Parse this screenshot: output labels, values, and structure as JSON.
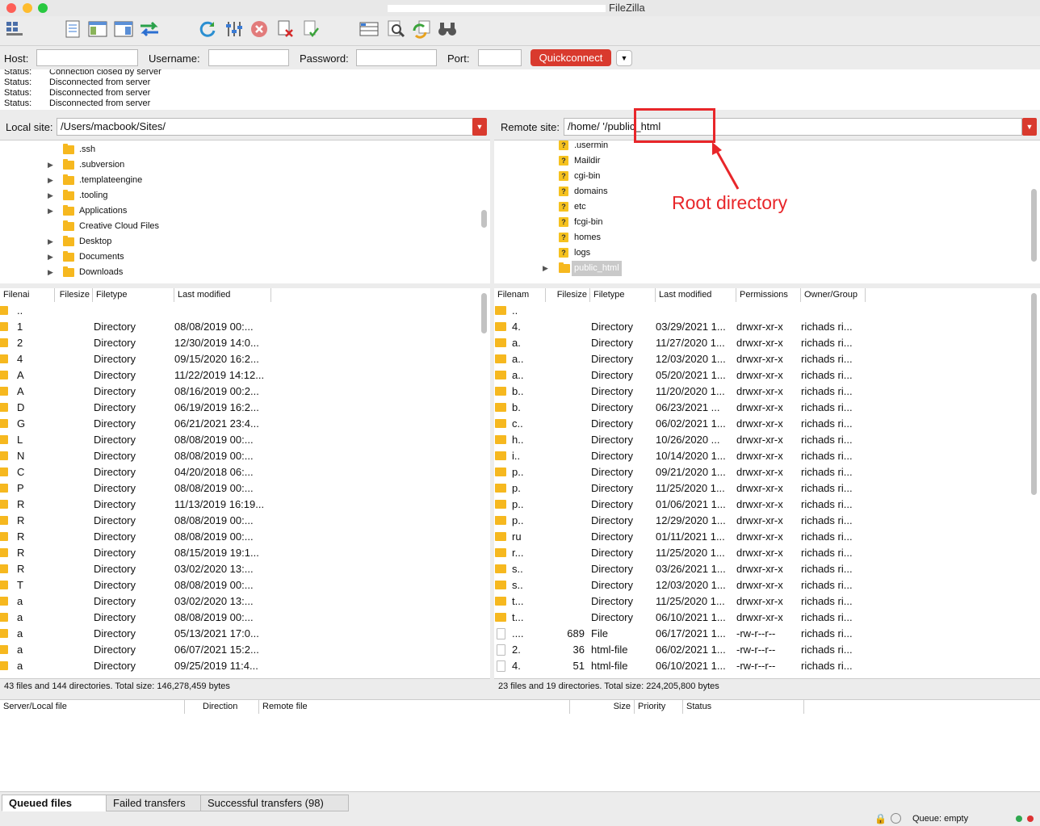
{
  "window": {
    "title": "FileZilla"
  },
  "toolbar": {
    "icons": [
      "site-manager-icon",
      "toggle-log-icon",
      "toggle-local-tree-icon",
      "toggle-remote-tree-icon",
      "transfer-queue-icon",
      "refresh-icon",
      "process-queue-icon",
      "cancel-icon",
      "disconnect-icon",
      "reconnect-icon",
      "filter-icon",
      "compare-icon",
      "sync-browse-icon",
      "search-icon"
    ]
  },
  "quickconnect": {
    "host_label": "Host:",
    "username_label": "Username:",
    "password_label": "Password:",
    "port_label": "Port:",
    "host_value": "",
    "username_value": "",
    "password_value": "",
    "port_value": "",
    "button_label": "Quickconnect"
  },
  "log": [
    {
      "key": "Status:",
      "msg": "Connection closed by server"
    },
    {
      "key": "Status:",
      "msg": "Disconnected from server"
    },
    {
      "key": "Status:",
      "msg": "Disconnected from server"
    },
    {
      "key": "Status:",
      "msg": "Disconnected from server"
    }
  ],
  "local": {
    "label": "Local site:",
    "path": "/Users/macbook/Sites/",
    "tree": [
      {
        "name": ".ssh",
        "arrow": false
      },
      {
        "name": ".subversion",
        "arrow": true
      },
      {
        "name": ".templateengine",
        "arrow": true
      },
      {
        "name": ".tooling",
        "arrow": true
      },
      {
        "name": "Applications",
        "arrow": true
      },
      {
        "name": "Creative Cloud Files",
        "arrow": false
      },
      {
        "name": "Desktop",
        "arrow": true
      },
      {
        "name": "Documents",
        "arrow": true
      },
      {
        "name": "Downloads",
        "arrow": true
      }
    ],
    "headers": [
      "Filenai",
      "Filesize",
      "Filetype",
      "Last modified"
    ],
    "rows": [
      {
        "n": "..",
        "t": "",
        "m": ""
      },
      {
        "n": "1",
        "t": "Directory",
        "m": "08/08/2019 00:..."
      },
      {
        "n": "2",
        "t": "Directory",
        "m": "12/30/2019 14:0..."
      },
      {
        "n": "4",
        "t": "Directory",
        "m": "09/15/2020 16:2..."
      },
      {
        "n": "A",
        "t": "Directory",
        "m": "11/22/2019 14:12..."
      },
      {
        "n": "A",
        "t": "Directory",
        "m": "08/16/2019 00:2..."
      },
      {
        "n": "D",
        "t": "Directory",
        "m": "06/19/2019 16:2..."
      },
      {
        "n": "G",
        "t": "Directory",
        "m": "06/21/2021 23:4..."
      },
      {
        "n": "L",
        "t": "Directory",
        "m": "08/08/2019 00:..."
      },
      {
        "n": "N",
        "t": "Directory",
        "m": "08/08/2019 00:..."
      },
      {
        "n": "C",
        "t": "Directory",
        "m": "04/20/2018 06:..."
      },
      {
        "n": "P",
        "t": "Directory",
        "m": "08/08/2019 00:..."
      },
      {
        "n": "R",
        "t": "Directory",
        "m": "11/13/2019 16:19..."
      },
      {
        "n": "R",
        "t": "Directory",
        "m": "08/08/2019 00:..."
      },
      {
        "n": "R",
        "t": "Directory",
        "m": "08/08/2019 00:..."
      },
      {
        "n": "R",
        "t": "Directory",
        "m": "08/15/2019 19:1..."
      },
      {
        "n": "R",
        "t": "Directory",
        "m": "03/02/2020 13:..."
      },
      {
        "n": "T",
        "t": "Directory",
        "m": "08/08/2019 00:..."
      },
      {
        "n": "a",
        "t": "Directory",
        "m": "03/02/2020 13:..."
      },
      {
        "n": "a",
        "t": "Directory",
        "m": "08/08/2019 00:..."
      },
      {
        "n": "a",
        "t": "Directory",
        "m": "05/13/2021 17:0..."
      },
      {
        "n": "a",
        "t": "Directory",
        "m": "06/07/2021 15:2..."
      },
      {
        "n": "a",
        "t": "Directory",
        "m": "09/25/2019 11:4..."
      }
    ],
    "status": "43 files and 144 directories. Total size: 146,278,459 bytes"
  },
  "remote": {
    "label": "Remote site:",
    "path": "/home/      '/public_html",
    "tree": [
      {
        "name": ".usermin",
        "selected": false
      },
      {
        "name": "Maildir",
        "selected": false
      },
      {
        "name": "cgi-bin",
        "selected": false
      },
      {
        "name": "domains",
        "selected": false
      },
      {
        "name": "etc",
        "selected": false
      },
      {
        "name": "fcgi-bin",
        "selected": false
      },
      {
        "name": "homes",
        "selected": false
      },
      {
        "name": "logs",
        "selected": false
      },
      {
        "name": "public_html",
        "selected": true
      }
    ],
    "headers": [
      "Filenam",
      "Filesize",
      "Filetype",
      "Last modified",
      "Permissions",
      "Owner/Group"
    ],
    "rows": [
      {
        "n": "..",
        "s": "",
        "t": "",
        "m": "",
        "p": "",
        "o": "",
        "kind": "folder"
      },
      {
        "n": "4.",
        "s": "",
        "t": "Directory",
        "m": "03/29/2021 1...",
        "p": "drwxr-xr-x",
        "o": "richads ri...",
        "kind": "folder"
      },
      {
        "n": "a.",
        "s": "",
        "t": "Directory",
        "m": "11/27/2020 1...",
        "p": "drwxr-xr-x",
        "o": "richads ri...",
        "kind": "folder"
      },
      {
        "n": "a..",
        "s": "",
        "t": "Directory",
        "m": "12/03/2020 1...",
        "p": "drwxr-xr-x",
        "o": "richads ri...",
        "kind": "folder"
      },
      {
        "n": "a..",
        "s": "",
        "t": "Directory",
        "m": "05/20/2021 1...",
        "p": "drwxr-xr-x",
        "o": "richads ri...",
        "kind": "folder"
      },
      {
        "n": "b..",
        "s": "",
        "t": "Directory",
        "m": "11/20/2020 1...",
        "p": "drwxr-xr-x",
        "o": "richads ri...",
        "kind": "folder"
      },
      {
        "n": "b.",
        "s": "",
        "t": "Directory",
        "m": "06/23/2021 ...",
        "p": "drwxr-xr-x",
        "o": "richads ri...",
        "kind": "folder"
      },
      {
        "n": "c..",
        "s": "",
        "t": "Directory",
        "m": "06/02/2021 1...",
        "p": "drwxr-xr-x",
        "o": "richads ri...",
        "kind": "folder"
      },
      {
        "n": "h..",
        "s": "",
        "t": "Directory",
        "m": "10/26/2020 ...",
        "p": "drwxr-xr-x",
        "o": "richads ri...",
        "kind": "folder"
      },
      {
        "n": "i..",
        "s": "",
        "t": "Directory",
        "m": "10/14/2020 1...",
        "p": "drwxr-xr-x",
        "o": "richads ri...",
        "kind": "folder"
      },
      {
        "n": "p..",
        "s": "",
        "t": "Directory",
        "m": "09/21/2020 1...",
        "p": "drwxr-xr-x",
        "o": "richads ri...",
        "kind": "folder"
      },
      {
        "n": "p.",
        "s": "",
        "t": "Directory",
        "m": "11/25/2020 1...",
        "p": "drwxr-xr-x",
        "o": "richads ri...",
        "kind": "folder"
      },
      {
        "n": "p..",
        "s": "",
        "t": "Directory",
        "m": "01/06/2021 1...",
        "p": "drwxr-xr-x",
        "o": "richads ri...",
        "kind": "folder"
      },
      {
        "n": "p..",
        "s": "",
        "t": "Directory",
        "m": "12/29/2020 1...",
        "p": "drwxr-xr-x",
        "o": "richads ri...",
        "kind": "folder"
      },
      {
        "n": "ru",
        "s": "",
        "t": "Directory",
        "m": "01/11/2021 1...",
        "p": "drwxr-xr-x",
        "o": "richads ri...",
        "kind": "folder"
      },
      {
        "n": "r...",
        "s": "",
        "t": "Directory",
        "m": "11/25/2020 1...",
        "p": "drwxr-xr-x",
        "o": "richads ri...",
        "kind": "folder"
      },
      {
        "n": "s..",
        "s": "",
        "t": "Directory",
        "m": "03/26/2021 1...",
        "p": "drwxr-xr-x",
        "o": "richads ri...",
        "kind": "folder"
      },
      {
        "n": "s..",
        "s": "",
        "t": "Directory",
        "m": "12/03/2020 1...",
        "p": "drwxr-xr-x",
        "o": "richads ri...",
        "kind": "folder"
      },
      {
        "n": "t...",
        "s": "",
        "t": "Directory",
        "m": "11/25/2020 1...",
        "p": "drwxr-xr-x",
        "o": "richads ri...",
        "kind": "folder"
      },
      {
        "n": "t...",
        "s": "",
        "t": "Directory",
        "m": "06/10/2021 1...",
        "p": "drwxr-xr-x",
        "o": "richads ri...",
        "kind": "folder"
      },
      {
        "n": "....",
        "s": "689",
        "t": "File",
        "m": "06/17/2021 1...",
        "p": "-rw-r--r--",
        "o": "richads ri...",
        "kind": "file"
      },
      {
        "n": "2.",
        "s": "36",
        "t": "html-file",
        "m": "06/02/2021 1...",
        "p": "-rw-r--r--",
        "o": "richads ri...",
        "kind": "file"
      },
      {
        "n": "4.",
        "s": "51",
        "t": "html-file",
        "m": "06/10/2021 1...",
        "p": "-rw-r--r--",
        "o": "richads ri...",
        "kind": "file"
      }
    ],
    "status": "23 files and 19 directories. Total size: 224,205,800 bytes"
  },
  "queue": {
    "headers": [
      "Server/Local file",
      "Direction",
      "Remote file",
      "Size",
      "Priority",
      "Status"
    ],
    "tabs": [
      "Queued files",
      "Failed transfers",
      "Successful transfers (98)"
    ],
    "queue_status": "Queue: empty"
  },
  "annotation": {
    "text": "Root directory",
    "color": "#e8262a"
  },
  "colors": {
    "accent": "#d93a2e",
    "folder": "#f6b81f",
    "selection": "#c9c9c9"
  }
}
